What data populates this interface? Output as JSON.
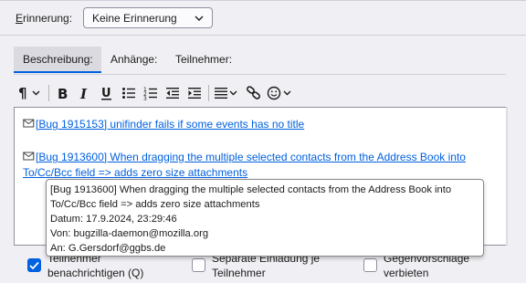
{
  "reminder": {
    "label_accel": "E",
    "label_rest": "rinnerung:",
    "value": "Keine Erinnerung"
  },
  "tabs": [
    {
      "label": "Beschreibung:",
      "selected": true
    },
    {
      "label": "Anhänge:",
      "selected": false
    },
    {
      "label": "Teilnehmer:",
      "selected": false
    }
  ],
  "toolbar": {
    "icons": [
      "paragraph-format-icon",
      "bold-icon",
      "italic-icon",
      "underline-icon",
      "bulleted-list-icon",
      "numbered-list-icon",
      "outdent-icon",
      "indent-icon",
      "align-icon",
      "insert-link-icon",
      "emoji-icon"
    ]
  },
  "editor": {
    "links": [
      {
        "text": "[Bug 1915153] unifinder fails if some events has no title"
      },
      {
        "line1": "[Bug 1913600] When dragging the multiple selected contacts from the Address Book into",
        "line2": "To/Cc/Bcc field => adds zero size attachments"
      }
    ]
  },
  "tooltip": {
    "line1": "[Bug 1913600] When dragging the multiple selected contacts from the Address Book into",
    "line2": "To/Cc/Bcc field => adds zero size attachments",
    "date": "Datum: 17.9.2024, 23:29:46",
    "from": "Von: bugzilla-daemon@mozilla.org",
    "to": "An: G.Gersdorf@ggbs.de"
  },
  "options": [
    {
      "line1": "Teilnehmer",
      "line2": "benachrichtigen (Q)",
      "checked": true
    },
    {
      "line1": "Separate Einladung je",
      "line2": "Teilnehmer",
      "checked": false
    },
    {
      "line1": "Gegenvorschläge",
      "line2": "verbieten",
      "checked": false
    }
  ],
  "colors": {
    "accent": "#0061e0",
    "link": "#0060df"
  }
}
